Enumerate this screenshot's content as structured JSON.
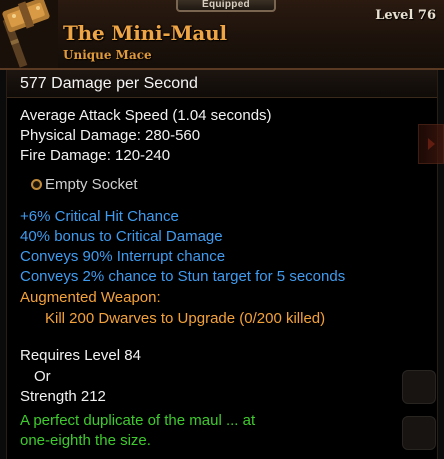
{
  "header": {
    "equipped_label": "Equipped",
    "item_name": "The Mini-Maul",
    "item_type": "Unique Mace",
    "level_label": "Level 76"
  },
  "stats": {
    "dps": "577  Damage per Second",
    "attack_speed": "Average Attack Speed (1.04 seconds)",
    "physical_damage": "Physical Damage: 280-560",
    "fire_damage": "Fire Damage: 120-240"
  },
  "socket": {
    "label": "Empty Socket"
  },
  "magic_properties": [
    "+6% Critical Hit Chance",
    "40% bonus to Critical Damage",
    "Conveys 90% Interrupt chance",
    "Conveys 2% chance to Stun target for 5 seconds"
  ],
  "augment": {
    "title": "Augmented Weapon:",
    "progress_text": "Kill 200 Dwarves to Upgrade (0/200 killed)"
  },
  "requirements": {
    "level": "Requires Level 84",
    "or": "Or",
    "strength": "Strength 212"
  },
  "flavor": {
    "line1": "A perfect duplicate of the maul ... at",
    "line2": "one-eighth the size."
  },
  "colors": {
    "unique_orange": "#f0a545",
    "magic_blue": "#3f9cf0",
    "flavor_green": "#3ecb2d"
  },
  "icons": [
    "mace-icon",
    "socket-icon",
    "side-arrow-icon",
    "chat-bubble-icon",
    "scroll-icon"
  ]
}
